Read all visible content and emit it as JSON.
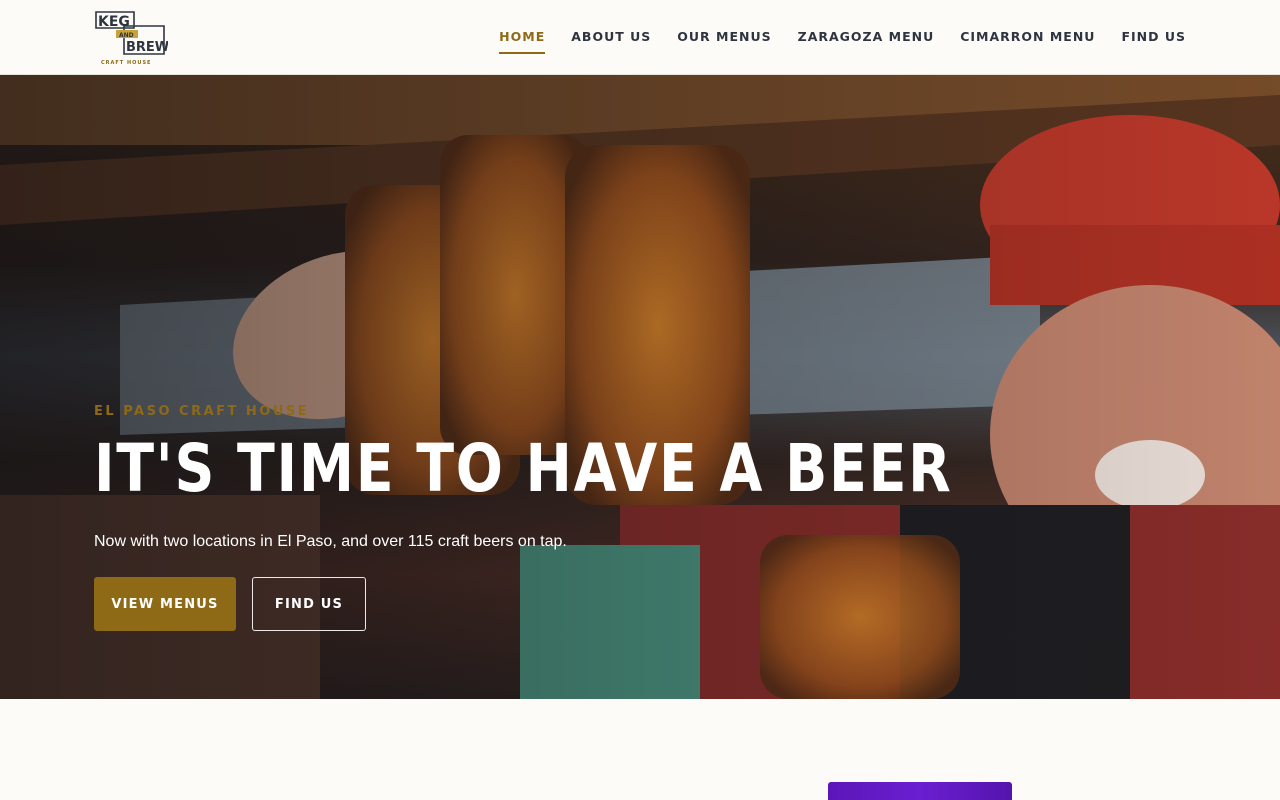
{
  "header": {
    "logo": {
      "name": "logo",
      "lines": [
        "KEG",
        "AND",
        "BREW",
        "CRAFT HOUSE"
      ]
    },
    "nav": [
      {
        "label": "HOME",
        "active": true
      },
      {
        "label": "ABOUT US",
        "active": false
      },
      {
        "label": "OUR MENUS",
        "active": false
      },
      {
        "label": "ZARAGOZA MENU",
        "active": false
      },
      {
        "label": "CIMARRON MENU",
        "active": false
      },
      {
        "label": "FIND US",
        "active": false
      }
    ]
  },
  "hero": {
    "eyebrow": "EL PASO CRAFT HOUSE",
    "headline": "IT'S TIME TO HAVE A BEER",
    "subtext": "Now with two locations in El Paso, and over 115 craft beers on tap.",
    "primary_button": "VIEW MENUS",
    "secondary_button": "FIND US"
  },
  "colors": {
    "accent": "#8e6a17",
    "nav_text": "#2f3540",
    "header_bg": "#fcfbf7",
    "purple": "#6a1fd0"
  }
}
